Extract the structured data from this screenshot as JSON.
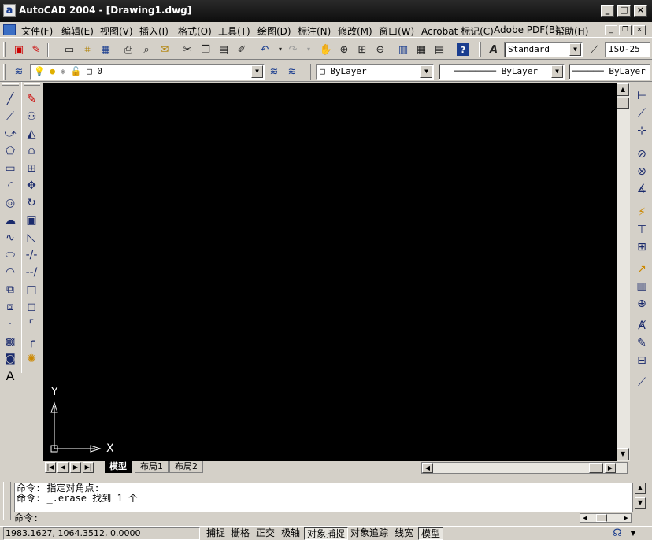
{
  "window": {
    "app_icon_letter": "a",
    "title": "AutoCAD 2004 - [Drawing1.dwg]",
    "minimize": "_",
    "maximize": "□",
    "close": "×"
  },
  "menu": [
    {
      "label": "文件(F)",
      "key": "file"
    },
    {
      "label": "编辑(E)",
      "key": "edit"
    },
    {
      "label": "视图(V)",
      "key": "view"
    },
    {
      "label": "插入(I)",
      "key": "insert"
    },
    {
      "label": "格式(O)",
      "key": "format"
    },
    {
      "label": "工具(T)",
      "key": "tools"
    },
    {
      "label": "绘图(D)",
      "key": "draw"
    },
    {
      "label": "标注(N)",
      "key": "dimension"
    },
    {
      "label": "修改(M)",
      "key": "modify"
    },
    {
      "label": "窗口(W)",
      "key": "window"
    },
    {
      "label": "Acrobat 标记(C)",
      "key": "acrobat"
    },
    {
      "label": "Adobe PDF(B)",
      "key": "adobe-pdf"
    },
    {
      "label": "帮助(H)",
      "key": "help"
    }
  ],
  "standard_toolbar": {
    "icons": [
      "pdf-convert-icon",
      "pdf-mark-icon",
      "new-icon",
      "open-icon",
      "save-icon",
      "print-icon",
      "print-preview-icon",
      "publish-icon",
      "cut-icon",
      "copy-icon",
      "paste-icon",
      "match-properties-icon",
      "undo-icon",
      "redo-icon",
      "pan-icon",
      "zoom-realtime-icon",
      "zoom-window-icon",
      "zoom-previous-icon",
      "properties-icon",
      "design-center-icon",
      "tool-palettes-icon",
      "help-icon"
    ]
  },
  "styles_toolbar": {
    "text_style": "Standard",
    "dim_style": "ISO-25"
  },
  "layers_toolbar": {
    "current_layer": "0"
  },
  "properties_toolbar": {
    "color": "ByLayer",
    "linetype": "ByLayer",
    "lineweight": "ByLayer"
  },
  "draw_toolbar": {
    "icons": [
      "line-icon",
      "construction-line-icon",
      "polyline-icon",
      "polygon-icon",
      "rectangle-icon",
      "arc-icon",
      "circle-icon",
      "revision-cloud-icon",
      "spline-icon",
      "ellipse-icon",
      "ellipse-arc-icon",
      "insert-block-icon",
      "make-block-icon",
      "point-icon",
      "hatch-icon",
      "region-icon",
      "multiline-text-icon"
    ],
    "text_tool_label": "A"
  },
  "modify_toolbar": {
    "icons": [
      "erase-icon",
      "copy-object-icon",
      "mirror-icon",
      "offset-icon",
      "array-icon",
      "move-icon",
      "rotate-icon",
      "scale-icon",
      "stretch-icon",
      "trim-icon",
      "extend-icon",
      "break-icon",
      "break-at-point-icon",
      "chamfer-icon",
      "fillet-icon",
      "explode-icon"
    ]
  },
  "dimension_toolbar": {
    "icons": [
      "linear-dim-icon",
      "aligned-dim-icon",
      "ordinate-dim-icon",
      "radius-dim-icon",
      "diameter-dim-icon",
      "angular-dim-icon",
      "quick-dim-icon",
      "baseline-dim-icon",
      "continue-dim-icon",
      "quick-leader-icon",
      "tolerance-icon",
      "center-mark-icon",
      "dim-edit-icon",
      "dim-text-edit-icon",
      "dim-update-icon",
      "dim-style-icon"
    ]
  },
  "canvas": {
    "ucs_y": "Y",
    "ucs_x": "X"
  },
  "layout_tabs": [
    {
      "label": "模型",
      "active": true
    },
    {
      "label": "布局1",
      "active": false
    },
    {
      "label": "布局2",
      "active": false
    }
  ],
  "command_window": {
    "history": [
      "命令: 指定对角点:",
      "命令: _.erase 找到 1 个"
    ],
    "prompt": "命令:"
  },
  "statusbar": {
    "coordinates": "1983.1627,  1064.3512,  0.0000",
    "buttons": [
      {
        "label": "捕捉",
        "on": false
      },
      {
        "label": "栅格",
        "on": false
      },
      {
        "label": "正交",
        "on": false
      },
      {
        "label": "极轴",
        "on": false
      },
      {
        "label": "对象捕捉",
        "on": true
      },
      {
        "label": "对象追踪",
        "on": false
      },
      {
        "label": "线宽",
        "on": false
      },
      {
        "label": "模型",
        "on": true
      }
    ]
  }
}
